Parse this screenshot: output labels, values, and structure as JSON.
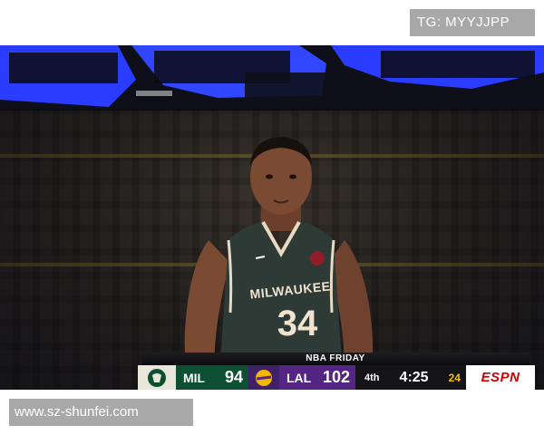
{
  "watermark_top": {
    "text": "TG: MYYJJPP"
  },
  "watermark_bottom": {
    "text": "www.sz-shunfei.com"
  },
  "player": {
    "jersey_name": "MILWAUKEE",
    "jersey_number": "34"
  },
  "scoreboard": {
    "banner": "NBA FRIDAY",
    "home": {
      "abbr": "MIL",
      "score": "94"
    },
    "away": {
      "abbr": "LAL",
      "score": "102"
    },
    "period": "4th",
    "clock": "4:25",
    "shot_clock": "24",
    "network": "ESPN"
  },
  "colors": {
    "bucks_green": "#0d4f33",
    "lakers_purple": "#552583",
    "shot_clock_yellow": "#f2c200",
    "arena_blue": "#2a3cff"
  }
}
